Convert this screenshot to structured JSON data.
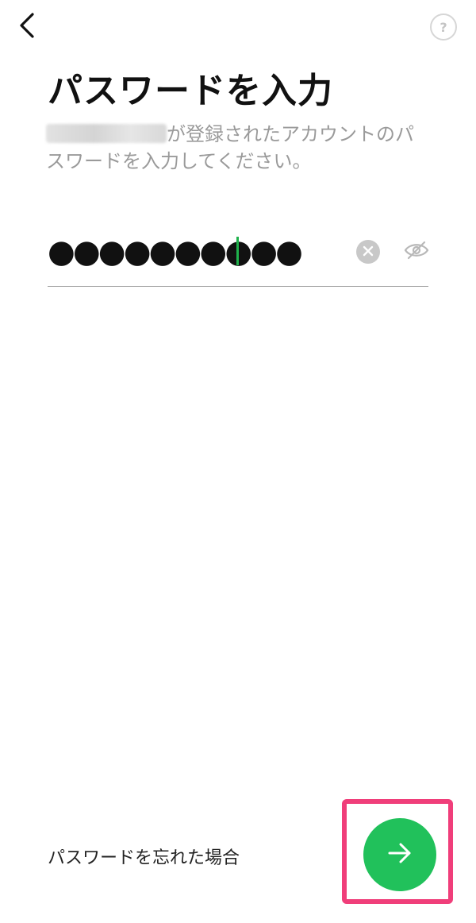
{
  "header": {
    "back_icon": "chevron-left-icon",
    "help_icon": "question-mark-icon",
    "help_label": "?"
  },
  "main": {
    "title": "パスワードを入力",
    "description_suffix": "が登録されたアカウントのパスワードを入力してください。",
    "password_field": {
      "masked_value": "●●●●●●●●●●",
      "clear_icon": "clear-circle-icon",
      "visibility_icon": "eye-off-icon"
    }
  },
  "footer": {
    "forgot_password_label": "パスワードを忘れた場合",
    "next_icon": "arrow-right-icon"
  },
  "colors": {
    "accent": "#21c15b",
    "caret": "#1fb24c",
    "highlight": "#f03e7a",
    "description_text": "#9a9a9a"
  }
}
